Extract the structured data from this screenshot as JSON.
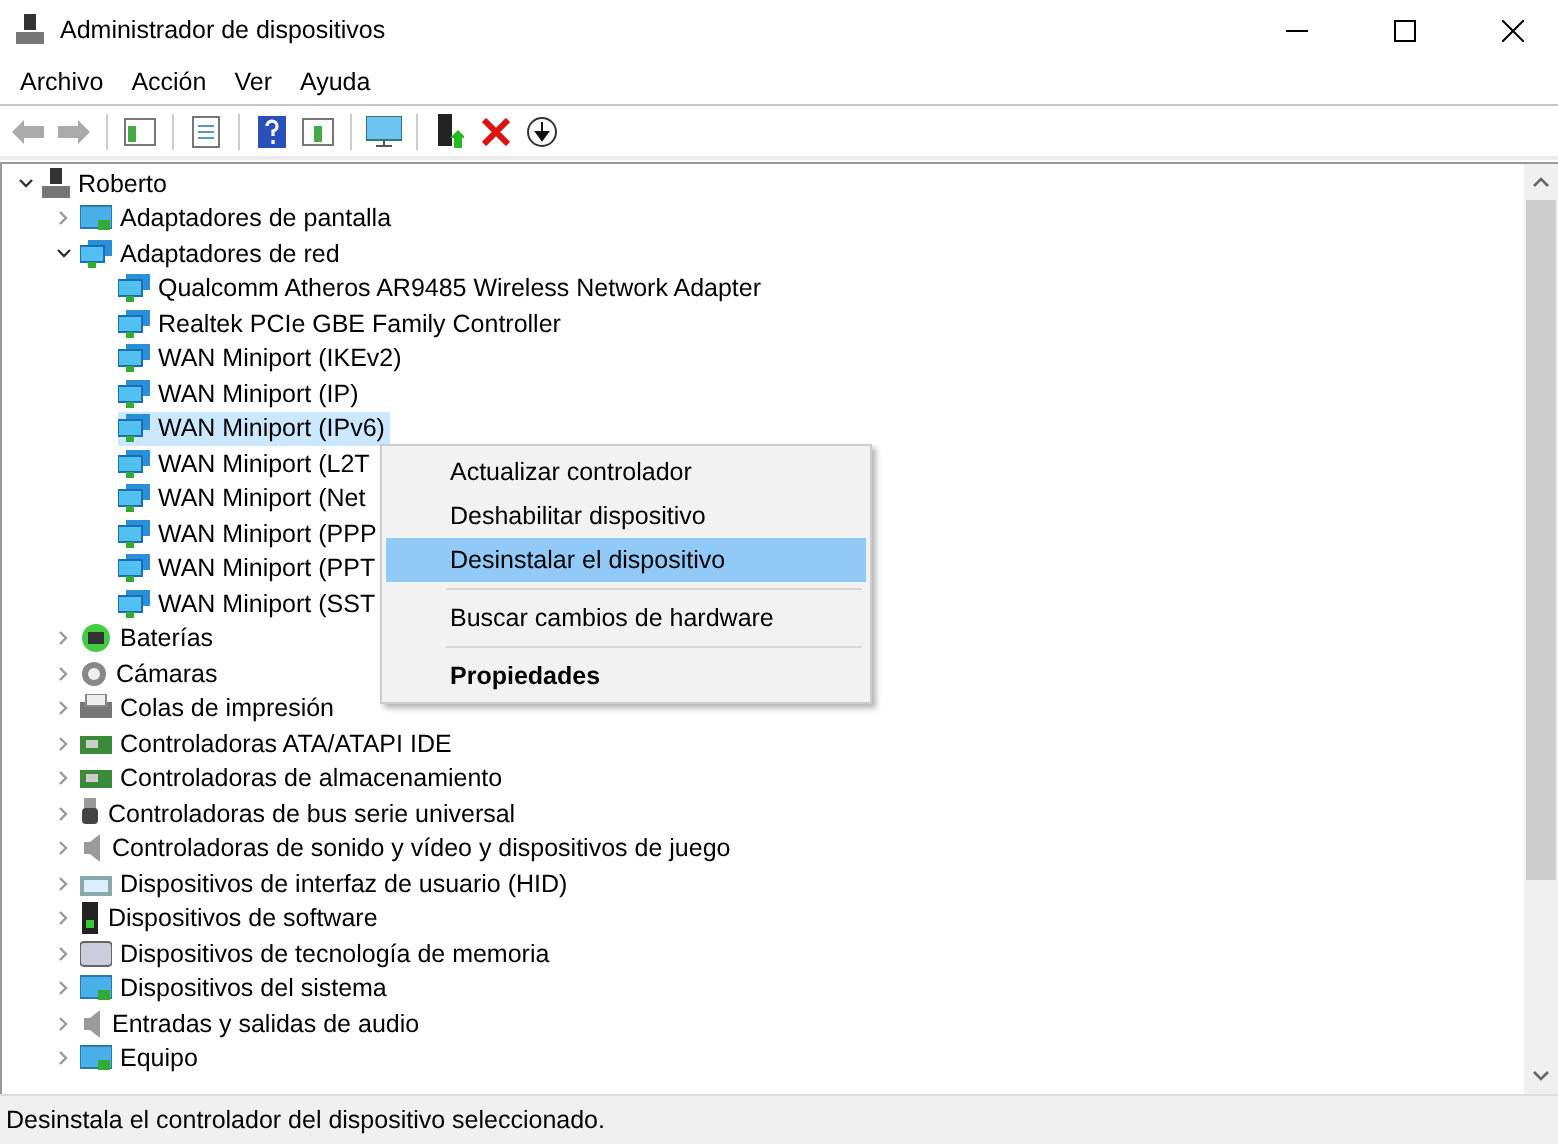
{
  "window": {
    "title": "Administrador de dispositivos"
  },
  "menu_bar": [
    "Archivo",
    "Acción",
    "Ver",
    "Ayuda"
  ],
  "tree": [
    {
      "label": "Roberto",
      "kind": "computer",
      "expanded": true,
      "selected": false,
      "children": [
        {
          "label": "Adaptadores de pantalla",
          "kind": "display",
          "expanded": false,
          "selected": false
        },
        {
          "label": "Adaptadores de red",
          "kind": "network",
          "expanded": true,
          "selected": false,
          "children": [
            {
              "label": "Qualcomm Atheros AR9485 Wireless Network Adapter",
              "kind": "network",
              "selected": false
            },
            {
              "label": "Realtek PCIe GBE Family Controller",
              "kind": "network",
              "selected": false
            },
            {
              "label": "WAN Miniport (IKEv2)",
              "kind": "network",
              "selected": false
            },
            {
              "label": "WAN Miniport (IP)",
              "kind": "network",
              "selected": false
            },
            {
              "label": "WAN Miniport (IPv6)",
              "kind": "network",
              "selected": true
            },
            {
              "label": "WAN Miniport (L2T",
              "kind": "network",
              "selected": false
            },
            {
              "label": "WAN Miniport (Net",
              "kind": "network",
              "selected": false
            },
            {
              "label": "WAN Miniport (PPP",
              "kind": "network",
              "selected": false
            },
            {
              "label": "WAN Miniport (PPT",
              "kind": "network",
              "selected": false
            },
            {
              "label": "WAN Miniport (SST",
              "kind": "network",
              "selected": false
            }
          ]
        },
        {
          "label": "Baterías",
          "kind": "battery",
          "expanded": false,
          "selected": false
        },
        {
          "label": "Cámaras",
          "kind": "camera",
          "expanded": false,
          "selected": false
        },
        {
          "label": "Colas de impresión",
          "kind": "printer",
          "expanded": false,
          "selected": false
        },
        {
          "label": "Controladoras ATA/ATAPI IDE",
          "kind": "chip",
          "expanded": false,
          "selected": false
        },
        {
          "label": "Controladoras de almacenamiento",
          "kind": "chip",
          "expanded": false,
          "selected": false
        },
        {
          "label": "Controladoras de bus serie universal",
          "kind": "usb",
          "expanded": false,
          "selected": false
        },
        {
          "label": "Controladoras de sonido y vídeo y dispositivos de juego",
          "kind": "speaker",
          "expanded": false,
          "selected": false
        },
        {
          "label": "Dispositivos de interfaz de usuario (HID)",
          "kind": "keyboard",
          "expanded": false,
          "selected": false
        },
        {
          "label": "Dispositivos de software",
          "kind": "tower",
          "expanded": false,
          "selected": false
        },
        {
          "label": "Dispositivos de tecnología de memoria",
          "kind": "card",
          "expanded": false,
          "selected": false
        },
        {
          "label": "Dispositivos del sistema",
          "kind": "display",
          "expanded": false,
          "selected": false
        },
        {
          "label": "Entradas y salidas de audio",
          "kind": "speaker",
          "expanded": false,
          "selected": false
        },
        {
          "label": "Equipo",
          "kind": "display",
          "expanded": false,
          "selected": false
        }
      ]
    }
  ],
  "context_menu": [
    {
      "label": "Actualizar controlador",
      "kind": "item",
      "selected": false
    },
    {
      "label": "Deshabilitar dispositivo",
      "kind": "item",
      "selected": false
    },
    {
      "label": "Desinstalar el dispositivo",
      "kind": "item",
      "selected": true
    },
    {
      "kind": "separator"
    },
    {
      "label": "Buscar cambios de hardware",
      "kind": "item",
      "selected": false
    },
    {
      "kind": "separator"
    },
    {
      "label": "Propiedades",
      "kind": "default",
      "selected": false
    }
  ],
  "status_bar": "Desinstala el controlador del dispositivo seleccionado."
}
